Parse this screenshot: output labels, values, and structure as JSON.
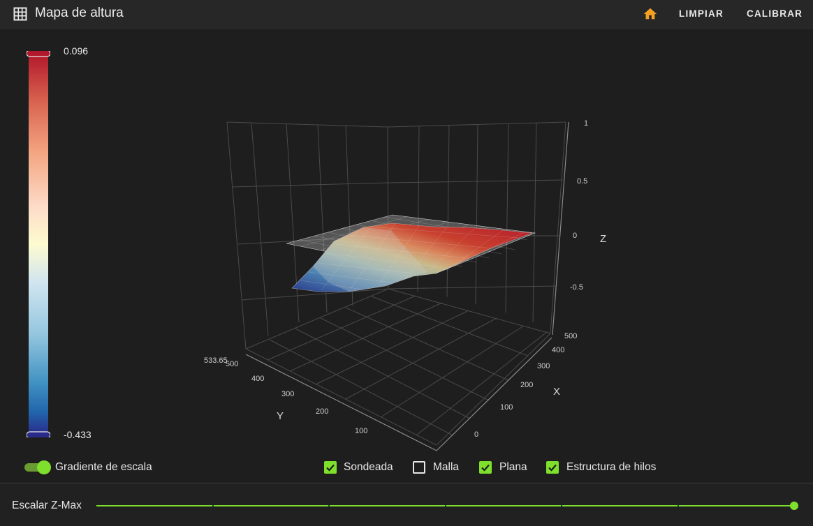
{
  "header": {
    "title": "Mapa de altura",
    "grid_icon": "grid-icon",
    "home_icon": "home-icon",
    "home_color": "#f5a020",
    "buttons": {
      "clear": "LIMPIAR",
      "calibrate": "CALIBRAR"
    }
  },
  "colorbar": {
    "max_label": "0.096",
    "min_label": "-0.433",
    "colors": [
      "#b2182b",
      "#d6604d",
      "#f4a582",
      "#fddbc7",
      "#fdfbd0",
      "#d1e5f0",
      "#92c5de",
      "#4393c3",
      "#2166ac",
      "#2a2a8a"
    ]
  },
  "plot": {
    "z_ticks": [
      "1",
      "0.5",
      "0",
      "-0.5"
    ],
    "x_ticks": [
      "500",
      "400",
      "300",
      "200",
      "100",
      "0"
    ],
    "y_ticks": [
      "500",
      "400",
      "300",
      "200",
      "100"
    ],
    "y_extra_tick": "533.65",
    "x_title": "X",
    "y_title": "Y",
    "z_title": "Z"
  },
  "controls": {
    "gradient_toggle_label": "Gradiente de escala",
    "gradient_toggle_on": true,
    "checkboxes": [
      {
        "label": "Sondeada",
        "checked": true
      },
      {
        "label": "Malla",
        "checked": false
      },
      {
        "label": "Plana",
        "checked": true
      },
      {
        "label": "Estructura de hilos",
        "checked": true
      }
    ]
  },
  "slider": {
    "label": "Escalar Z-Max",
    "value_fraction": 1.0
  },
  "accent_color": "#7ee02c"
}
